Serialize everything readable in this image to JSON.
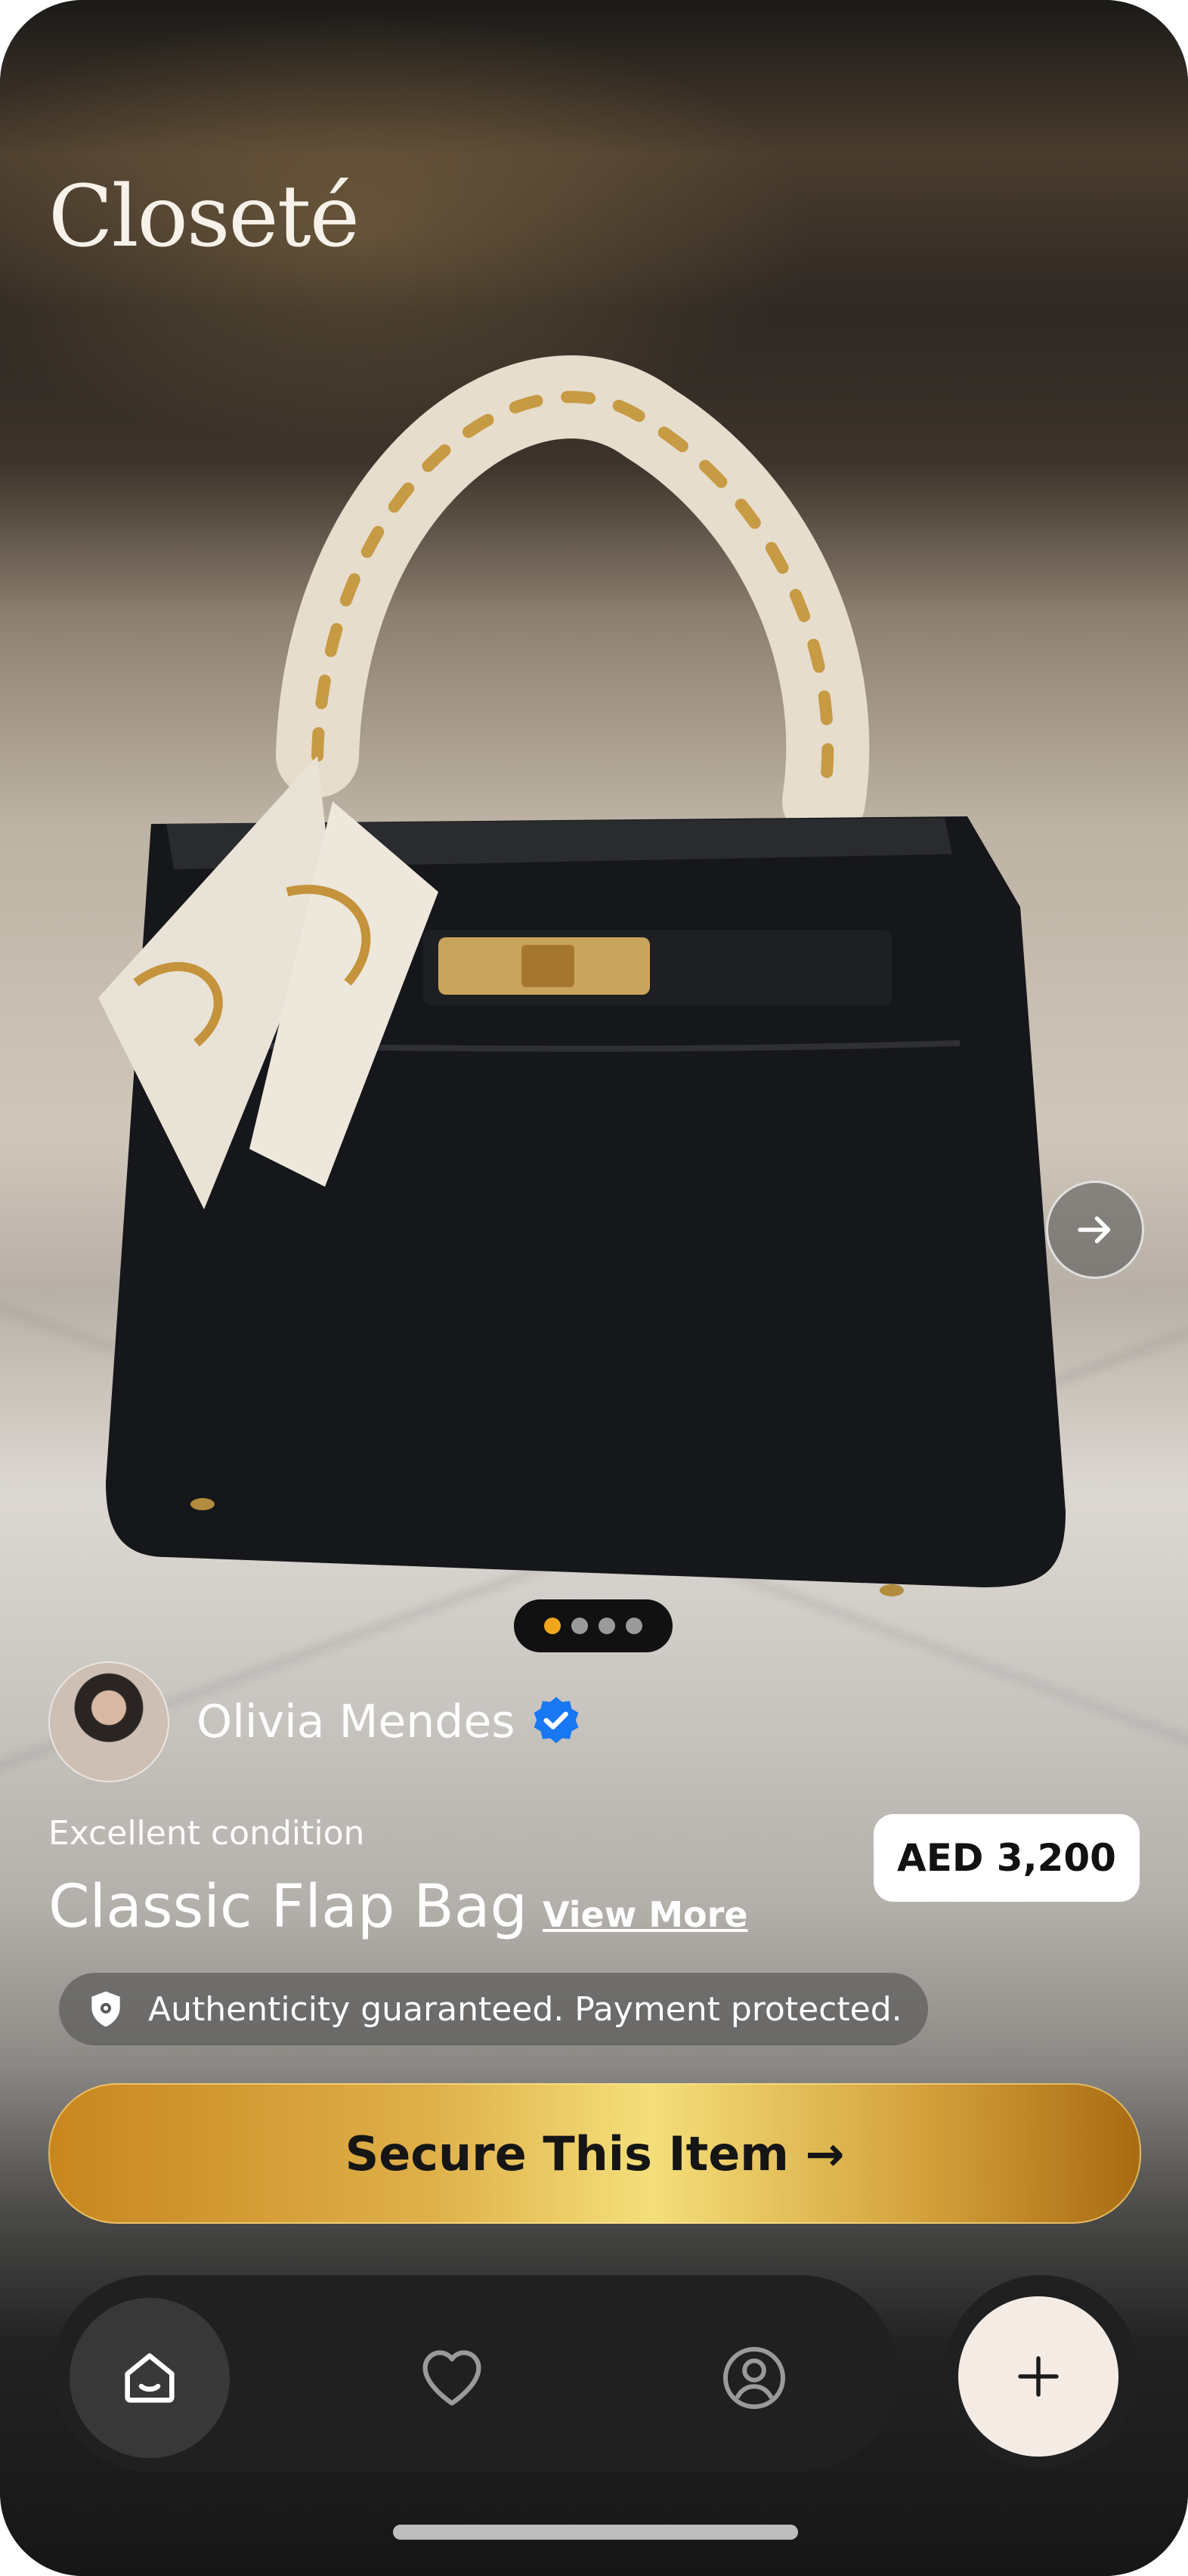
{
  "app": {
    "brand": "Closeté"
  },
  "carousel": {
    "total": 4,
    "active_index": 0,
    "next_icon": "arrow-right-icon"
  },
  "seller": {
    "name": "Olivia Mendes",
    "verified_icon": "verified-badge-icon"
  },
  "product": {
    "condition": "Excellent condition",
    "title": "Classic Flap Bag",
    "view_more": "View More",
    "price": "AED 3,200"
  },
  "trust": {
    "icon": "shield-icon",
    "text": "Authenticity guaranteed. Payment protected."
  },
  "cta": {
    "label": "Secure This Item →"
  },
  "nav": {
    "items": [
      {
        "icon": "home-icon",
        "active": true
      },
      {
        "icon": "heart-icon",
        "active": false
      },
      {
        "icon": "profile-icon",
        "active": false
      }
    ],
    "fab_icon": "plus-icon"
  },
  "colors": {
    "accent_gold": "#f2a71b",
    "verified_blue": "#1877f2",
    "fab_bg": "#f4ebe5"
  }
}
